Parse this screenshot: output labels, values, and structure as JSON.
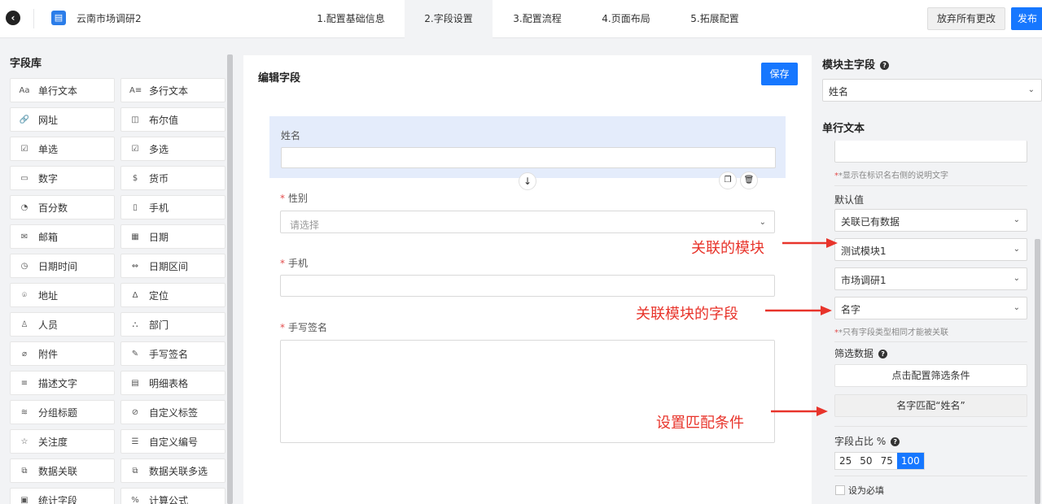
{
  "header": {
    "back_icon": "back-circle-icon",
    "app_icon": "form-app-icon",
    "app_title": "云南市场调研2",
    "steps": [
      "1.配置基础信息",
      "2.字段设置",
      "3.配置流程",
      "4.页面布局",
      "5.拓展配置"
    ],
    "active_step": 1,
    "discard_label": "放弃所有更改",
    "publish_label": "发布"
  },
  "library": {
    "title": "字段库",
    "items": [
      {
        "icon": "Aa",
        "label": "单行文本"
      },
      {
        "icon": "A≡",
        "label": "多行文本"
      },
      {
        "icon": "🔗",
        "label": "网址"
      },
      {
        "icon": "◫",
        "label": "布尔值"
      },
      {
        "icon": "☑",
        "label": "单选"
      },
      {
        "icon": "☑",
        "label": "多选"
      },
      {
        "icon": "▭",
        "label": "数字"
      },
      {
        "icon": "$",
        "label": "货币"
      },
      {
        "icon": "◔",
        "label": "百分数"
      },
      {
        "icon": "▯",
        "label": "手机"
      },
      {
        "icon": "✉",
        "label": "邮箱"
      },
      {
        "icon": "▦",
        "label": "日期"
      },
      {
        "icon": "◷",
        "label": "日期时间"
      },
      {
        "icon": "⇔",
        "label": "日期区间"
      },
      {
        "icon": "⌾",
        "label": "地址"
      },
      {
        "icon": "Δ",
        "label": "定位"
      },
      {
        "icon": "♙",
        "label": "人员"
      },
      {
        "icon": "⛬",
        "label": "部门"
      },
      {
        "icon": "⌀",
        "label": "附件"
      },
      {
        "icon": "✎",
        "label": "手写签名"
      },
      {
        "icon": "≡",
        "label": "描述文字"
      },
      {
        "icon": "▤",
        "label": "明细表格"
      },
      {
        "icon": "≋",
        "label": "分组标题"
      },
      {
        "icon": "⊘",
        "label": "自定义标签"
      },
      {
        "icon": "☆",
        "label": "关注度"
      },
      {
        "icon": "☰",
        "label": "自定义编号"
      },
      {
        "icon": "⧉",
        "label": "数据关联"
      },
      {
        "icon": "⧉",
        "label": "数据关联多选"
      },
      {
        "icon": "▣",
        "label": "统计字段"
      },
      {
        "icon": "%",
        "label": "计算公式"
      }
    ]
  },
  "editor": {
    "title": "编辑字段",
    "save_label": "保存",
    "fields": {
      "name_label": "姓名",
      "gender_label": "性别",
      "gender_placeholder": "请选择",
      "phone_label": "手机",
      "signature_label": "手写签名"
    }
  },
  "right_panel": {
    "main_field_title": "模块主字段",
    "main_field_value": "姓名",
    "section_title": "单行文本",
    "desc_hint": "*显示在标识名右侧的说明文字",
    "default_label": "默认值",
    "default_value": "关联已有数据",
    "module_value": "测试模块1",
    "app_value": "市场调研1",
    "field_value": "名字",
    "link_hint": "*只有字段类型相同才能被关联",
    "filter_label": "筛选数据",
    "filter_btn": "点击配置筛选条件",
    "match_btn": "名字匹配“姓名”",
    "ratio_label": "字段占比 %",
    "ratio_options": [
      "25",
      "50",
      "75",
      "100"
    ],
    "ratio_selected": "100",
    "required_label": "设为必填"
  },
  "annotations": {
    "linked_module": "关联的模块",
    "linked_field": "关联模块的字段",
    "match_condition": "设置匹配条件"
  },
  "colors": {
    "primary": "#1677ff",
    "selected_bg": "#e4ecfb",
    "annotation": "#e8342b"
  }
}
